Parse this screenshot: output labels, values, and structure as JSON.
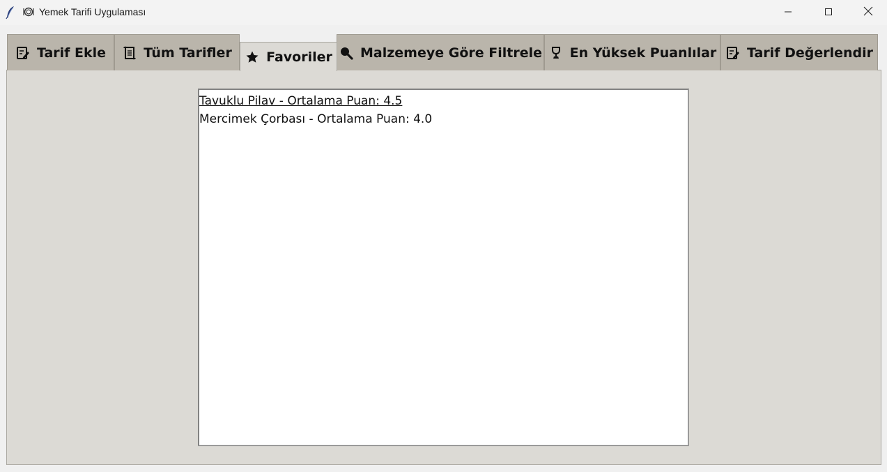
{
  "window": {
    "title": "Yemek Tarifi Uygulaması",
    "app_icon": "feather-icon",
    "title_icon": "plate-icon",
    "controls": [
      "minimize-icon",
      "maximize-icon",
      "close-icon"
    ]
  },
  "tabs": [
    {
      "label": "Tarif Ekle",
      "icon": "memo-icon"
    },
    {
      "label": "Tüm Tarifler",
      "icon": "scroll-icon"
    },
    {
      "label": "Favoriler",
      "icon": "star-icon",
      "selected": true
    },
    {
      "label": "Malzemeye Göre Filtrele",
      "icon": "magnifier-icon"
    },
    {
      "label": "En Yüksek Puanlılar",
      "icon": "trophy-icon"
    },
    {
      "label": "Tarif Değerlendir",
      "icon": "memo-icon"
    }
  ],
  "favorites": {
    "items": [
      {
        "text": "Tavuklu Pilav - Ortalama Puan: 4.5",
        "active": true
      },
      {
        "text": "Mercimek Çorbası - Ortalama Puan: 4.0",
        "active": false
      }
    ]
  },
  "colors": {
    "panel": "#dcdad5",
    "tab_inactive": "#bab5ab",
    "list_bg": "#ffffff"
  }
}
